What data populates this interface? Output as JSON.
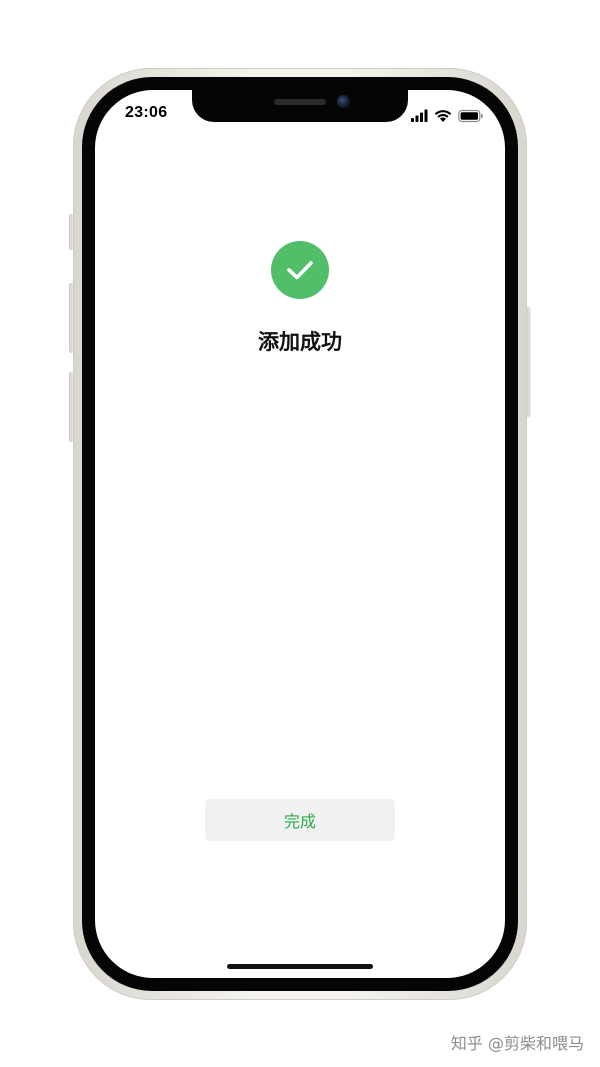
{
  "status_bar": {
    "time": "23:06",
    "icons": [
      "signal-icon",
      "wifi-icon",
      "battery-icon"
    ]
  },
  "result": {
    "icon": "checkmark-icon",
    "title": "添加成功",
    "icon_color": "#51be6a"
  },
  "actions": {
    "done_label": "完成",
    "done_color": "#2fa94e"
  },
  "watermark": {
    "text": "知乎 @剪柴和喂马"
  }
}
